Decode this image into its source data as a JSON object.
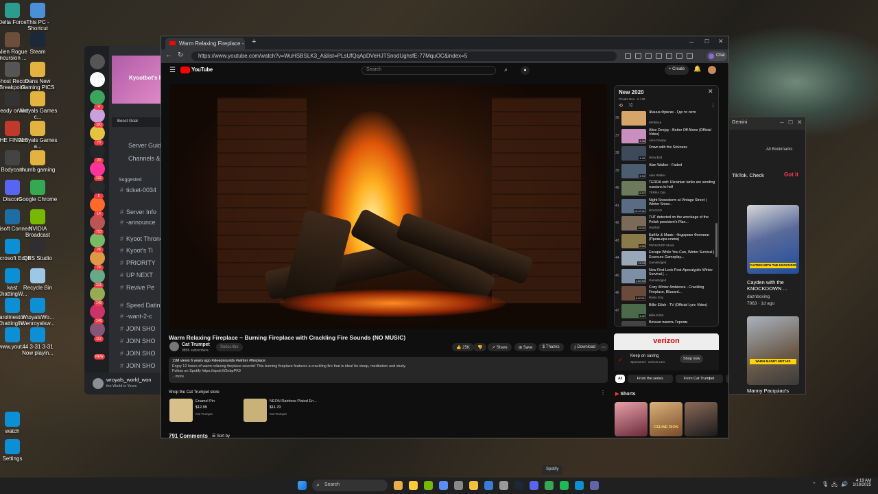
{
  "desktop_icons": [
    {
      "label": "Delta Force",
      "color": "#2a9d8f"
    },
    {
      "label": "This PC - Shortcut",
      "color": "#4a90d9"
    },
    {
      "label": "Alien Rogue Incursion ...",
      "color": "#6b4f3a"
    },
    {
      "label": "Steam",
      "color": "#1b2838"
    },
    {
      "label": "Ghost Recon Breakpoint",
      "color": "#555"
    },
    {
      "label": "Dans New Gaming PICS",
      "color": "#e3b341"
    },
    {
      "label": "Ready or Not",
      "color": "#333"
    },
    {
      "label": "Wroyals Games c...",
      "color": "#e3b341"
    },
    {
      "label": "THE FINALS",
      "color": "#c0392b"
    },
    {
      "label": "Wroyals Games a...",
      "color": "#e3b341"
    },
    {
      "label": "Bodycam",
      "color": "#444"
    },
    {
      "label": "thumb gaming",
      "color": "#e3b341"
    },
    {
      "label": "Discord",
      "color": "#5865f2"
    },
    {
      "label": "Google Chrome",
      "color": "#34a853"
    },
    {
      "label": "Ubisoft Connect",
      "color": "#1c6ea4"
    },
    {
      "label": "NVIDIA Broadcast",
      "color": "#76b900"
    },
    {
      "label": "Microsoft Edge",
      "color": "#0c8fd4"
    },
    {
      "label": "OBS Studio",
      "color": "#302e31"
    },
    {
      "label": "kast ChattingW...",
      "color": "#0c8fd4"
    },
    {
      "label": "Recycle Bin",
      "color": "#9cc7e6"
    },
    {
      "label": "Carolinestor... Chattingliv...",
      "color": "#0c8fd4"
    },
    {
      "label": "WroyalsWo... Wenroyalsw...",
      "color": "#0c8fd4"
    },
    {
      "label": "www.yout...",
      "color": "#0c8fd4"
    },
    {
      "label": "44 3-31 3-31 Now playin...",
      "color": "#0c8fd4"
    },
    {
      "label": "watch",
      "color": "#0c8fd4"
    },
    {
      "label": "Settings",
      "color": "#0c8fd4"
    }
  ],
  "discord": {
    "banner_title": "Kyootbot's Ky",
    "boost": "Boost Goal",
    "menu": [
      "Server Guide",
      "Channels & R"
    ],
    "suggested": "Suggested",
    "channels": [
      "ticket-0034",
      "Server Info",
      "-announce",
      "Kyoot Throne",
      "Kyoot's Ti",
      "PRIORITY",
      "UP NEXT",
      "Revive Pe",
      "Speed Dating",
      "-want-2-c",
      "JOIN SHO",
      "JOIN SHO",
      "JOIN SHO",
      "JOIN SHO"
    ],
    "badges": [
      "4",
      "100",
      "79",
      "23",
      "132",
      "5",
      "14",
      "753",
      "24",
      "74",
      "231",
      "149",
      "149",
      "112",
      "NEW"
    ],
    "user": "wroyals_world_won",
    "status": "the World is Yours"
  },
  "gemini": {
    "tab": "Gemini",
    "bookmarks": "All Bookmarks",
    "banner": "TikTok. Check",
    "got_it": "Got it",
    "card_title": "Cayden with the KNOCKDOWN ...",
    "card_channel": "daznboxing",
    "card_meta": "7963 · 1d ago",
    "card2_title": "Manny Pacquiao's",
    "thumb1_caption": "CAYDEN WITH THE KNOCKDOWN",
    "thumb2_caption": "WHEN MANNY MET HIS"
  },
  "browser": {
    "tab_title": "Warm Relaxing Fireplace - B",
    "url": "https://www.youtube.com/watch?v=WuHSBSLK3_A&list=PLsUfQqApDVeHJTSnodUghsfE-77MquOC&index=5",
    "chat_label": "Chat"
  },
  "youtube": {
    "logo": "YouTube",
    "search_placeholder": "Search",
    "create": "Create",
    "video_title": "Warm Relaxing Fireplace ~ Burning Fireplace with Crackling Fire Sounds (NO MUSIC)",
    "channel": "Cat Trumpet",
    "subscribers": "985K subscribers",
    "subscribe": "Subscribe",
    "likes": "25K",
    "share": "Share",
    "save": "Save",
    "thanks": "Thanks",
    "download": "Download",
    "desc_line1": "11M views  6 years ago  #sleepsounds #winter #fireplace",
    "desc_line2": "Enjoy 12 hours of warm relaxing fireplace sounds! This burning fireplace features a crackling fire that is ideal for sleep, meditation and study.",
    "desc_line3": "Follow on Spotify https://spoti.fi/2nbpPK9",
    "desc_more": "...more",
    "store_heading": "Shop the Cat Trumpet store",
    "products": [
      {
        "name": "Enamel Pin",
        "price": "$12.99",
        "seller": "Cat Trumpet"
      },
      {
        "name": "NEON Rainbow Plated En...",
        "price": "$11.70",
        "seller": "Cat Trumpet"
      }
    ],
    "comments": "791 Comments",
    "sort_by": "Sort by",
    "playlist": {
      "title": "New 2020",
      "meta": "Private  Ben - 6 / 80",
      "items": [
        {
          "n": "36",
          "title": "Жанна Фриске - Где то лето",
          "channel": "MP3Nice",
          "dur": "",
          "color": "#d7a56a"
        },
        {
          "n": "37",
          "title": "Alice Deejay - Better Off Alone (Official Video)",
          "channel": "Alice Deejay",
          "dur": "3:36",
          "color": "#c98fbf"
        },
        {
          "n": "38",
          "title": "Down with the Sickness",
          "channel": "Disturbed",
          "dur": "4:40",
          "color": "#3e4a5a"
        },
        {
          "n": "39",
          "title": "Alan Walker - Faded",
          "channel": "Alan Walker",
          "dur": "3:33",
          "color": "#4b5d6e"
        },
        {
          "n": "40",
          "title": "TERRA unit: Ukrainian tanks are sending russians to hell",
          "channel": "TERRA Ops",
          "dur": "5:37",
          "color": "#6a7a5a"
        },
        {
          "n": "41",
          "title": "Night Snowstorm at Vintage Street | Winter Snow...",
          "channel": "DOVADO",
          "dur": "10:10:11",
          "color": "#5a6c84"
        },
        {
          "n": "42",
          "title": "THT detected on the wreckage of the Polish president's Plan...",
          "channel": "Hrydlod",
          "dur": "12:00",
          "color": "#7a6a5a"
        },
        {
          "n": "43",
          "title": "Баббл & Мавік - Федерико Феллини (Премьера клипа)",
          "channel": "PIZHKINOP Music",
          "dur": "2:55",
          "color": "#8a7a4a"
        },
        {
          "n": "44",
          "title": "Escape While You Can, Winter Survival | Ecureuro Gameplay...",
          "channel": "GameEdged",
          "dur": "13:33",
          "color": "#9aa7b8"
        },
        {
          "n": "45",
          "title": "New First Look Post-Apocalyptic Winter Survival | ...",
          "channel": "GameEdged",
          "dur": "1:00:33",
          "color": "#7d8fa5"
        },
        {
          "n": "46",
          "title": "Cozy Winter Ambience - Crackling Fireplace, Blizzard...",
          "channel": "Rainy Guy",
          "dur": "8:00:51",
          "color": "#6a4a3a"
        },
        {
          "n": "47",
          "title": "Billie Eilish - TV (Official Lyric Video)",
          "channel": "Billie Eilish",
          "dur": "4:42",
          "color": "#4a6a4a"
        },
        {
          "n": "48",
          "title": "Вечная память Героям",
          "channel": "",
          "dur": "",
          "color": "#444"
        }
      ]
    },
    "ad": {
      "brand": "verizon",
      "headline": "Keep on saving",
      "sponsored": "Sponsored · verizon.com",
      "cta": "Shop now"
    },
    "chips": [
      "All",
      "From the series",
      "From Cat Trumpet",
      "R"
    ],
    "shorts": "Shorts",
    "short_caption": "CELINE DION"
  },
  "taskbar": {
    "search": "Search",
    "tooltip": "Spotify",
    "time": "4:19 AM",
    "date": "1/18/2025"
  }
}
